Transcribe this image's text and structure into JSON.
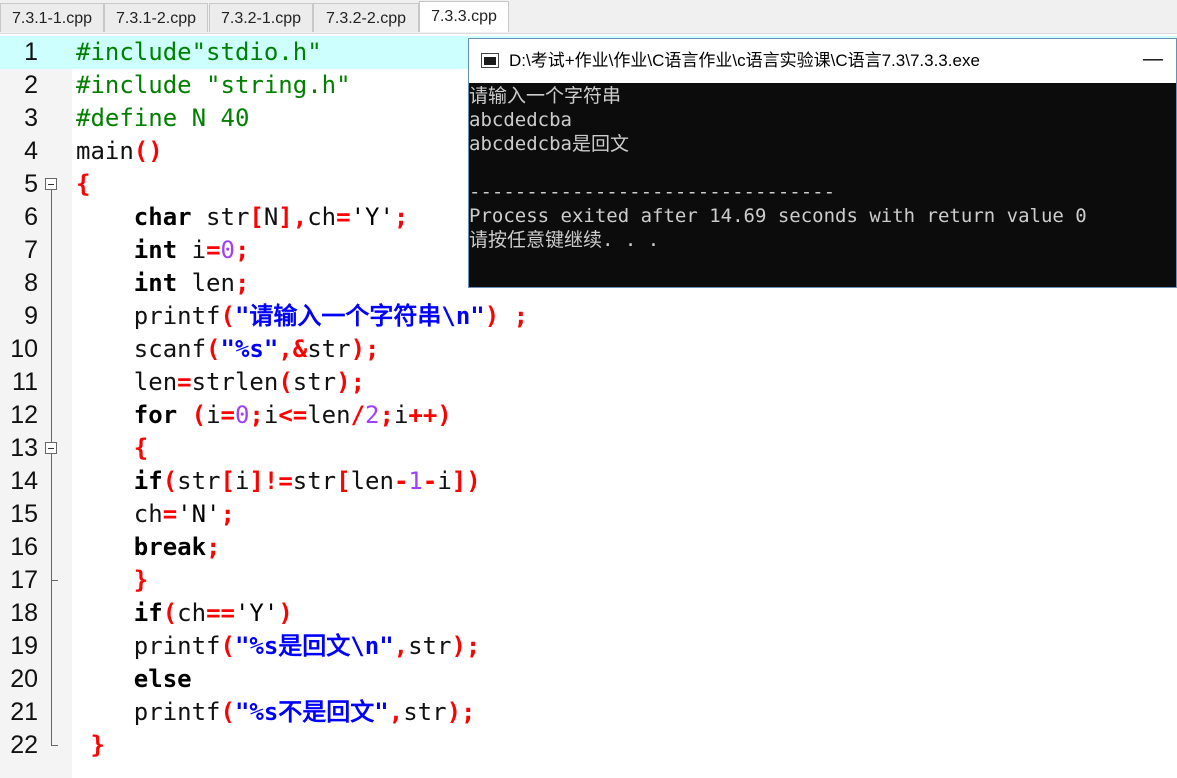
{
  "tabs": [
    "7.3.1-1.cpp",
    "7.3.1-2.cpp",
    "7.3.2-1.cpp",
    "7.3.2-2.cpp",
    "7.3.3.cpp"
  ],
  "active_tab": "7.3.3.cpp",
  "line_numbers": [
    "1",
    "2",
    "3",
    "4",
    "5",
    "6",
    "7",
    "8",
    "9",
    "10",
    "11",
    "12",
    "13",
    "14",
    "15",
    "16",
    "17",
    "18",
    "19",
    "20",
    "21",
    "22"
  ],
  "code": [
    [
      {
        "t": "#include\"stdio.h\"",
        "c": "pp"
      }
    ],
    [
      {
        "t": "#include \"string.h\"",
        "c": "pp"
      }
    ],
    [
      {
        "t": "#define N 40",
        "c": "pp"
      }
    ],
    [
      {
        "t": "main",
        "c": "id"
      },
      {
        "t": "()",
        "c": "sym"
      }
    ],
    [
      {
        "t": "{",
        "c": "sym"
      }
    ],
    [
      {
        "t": "    ",
        "c": "id"
      },
      {
        "t": "char",
        "c": "kw"
      },
      {
        "t": " str",
        "c": "id"
      },
      {
        "t": "[",
        "c": "sym"
      },
      {
        "t": "N",
        "c": "id"
      },
      {
        "t": "],",
        "c": "sym"
      },
      {
        "t": "ch",
        "c": "id"
      },
      {
        "t": "=",
        "c": "sym"
      },
      {
        "t": "'Y'",
        "c": "chr"
      },
      {
        "t": ";",
        "c": "sym"
      }
    ],
    [
      {
        "t": "    ",
        "c": "id"
      },
      {
        "t": "int",
        "c": "kw"
      },
      {
        "t": " i",
        "c": "id"
      },
      {
        "t": "=",
        "c": "sym"
      },
      {
        "t": "0",
        "c": "num"
      },
      {
        "t": ";",
        "c": "sym"
      }
    ],
    [
      {
        "t": "    ",
        "c": "id"
      },
      {
        "t": "int",
        "c": "kw"
      },
      {
        "t": " len",
        "c": "id"
      },
      {
        "t": ";",
        "c": "sym"
      }
    ],
    [
      {
        "t": "    printf",
        "c": "id"
      },
      {
        "t": "(",
        "c": "sym"
      },
      {
        "t": "\"请输入一个字符串\\n\"",
        "c": "str"
      },
      {
        "t": ") ;",
        "c": "sym"
      }
    ],
    [
      {
        "t": "    scanf",
        "c": "id"
      },
      {
        "t": "(",
        "c": "sym"
      },
      {
        "t": "\"%s\"",
        "c": "str"
      },
      {
        "t": ",&",
        "c": "sym"
      },
      {
        "t": "str",
        "c": "id"
      },
      {
        "t": ");",
        "c": "sym"
      }
    ],
    [
      {
        "t": "    len",
        "c": "id"
      },
      {
        "t": "=",
        "c": "sym"
      },
      {
        "t": "strlen",
        "c": "id"
      },
      {
        "t": "(",
        "c": "sym"
      },
      {
        "t": "str",
        "c": "id"
      },
      {
        "t": ");",
        "c": "sym"
      }
    ],
    [
      {
        "t": "    ",
        "c": "id"
      },
      {
        "t": "for",
        "c": "kw"
      },
      {
        "t": " ",
        "c": "id"
      },
      {
        "t": "(",
        "c": "sym"
      },
      {
        "t": "i",
        "c": "id"
      },
      {
        "t": "=",
        "c": "sym"
      },
      {
        "t": "0",
        "c": "num"
      },
      {
        "t": ";",
        "c": "sym"
      },
      {
        "t": "i",
        "c": "id"
      },
      {
        "t": "<=",
        "c": "sym"
      },
      {
        "t": "len",
        "c": "id"
      },
      {
        "t": "/",
        "c": "sym"
      },
      {
        "t": "2",
        "c": "num"
      },
      {
        "t": ";",
        "c": "sym"
      },
      {
        "t": "i",
        "c": "id"
      },
      {
        "t": "++)",
        "c": "sym"
      }
    ],
    [
      {
        "t": "    ",
        "c": "id"
      },
      {
        "t": "{",
        "c": "sym"
      }
    ],
    [
      {
        "t": "    ",
        "c": "id"
      },
      {
        "t": "if",
        "c": "kw"
      },
      {
        "t": "(",
        "c": "sym"
      },
      {
        "t": "str",
        "c": "id"
      },
      {
        "t": "[",
        "c": "sym"
      },
      {
        "t": "i",
        "c": "id"
      },
      {
        "t": "]!=",
        "c": "sym"
      },
      {
        "t": "str",
        "c": "id"
      },
      {
        "t": "[",
        "c": "sym"
      },
      {
        "t": "len",
        "c": "id"
      },
      {
        "t": "-",
        "c": "sym"
      },
      {
        "t": "1",
        "c": "num"
      },
      {
        "t": "-",
        "c": "sym"
      },
      {
        "t": "i",
        "c": "id"
      },
      {
        "t": "])",
        "c": "sym"
      }
    ],
    [
      {
        "t": "    ch",
        "c": "id"
      },
      {
        "t": "=",
        "c": "sym"
      },
      {
        "t": "'N'",
        "c": "chr"
      },
      {
        "t": ";",
        "c": "sym"
      }
    ],
    [
      {
        "t": "    ",
        "c": "id"
      },
      {
        "t": "break",
        "c": "kw"
      },
      {
        "t": ";",
        "c": "sym"
      }
    ],
    [
      {
        "t": "    ",
        "c": "id"
      },
      {
        "t": "}",
        "c": "sym"
      }
    ],
    [
      {
        "t": "    ",
        "c": "id"
      },
      {
        "t": "if",
        "c": "kw"
      },
      {
        "t": "(",
        "c": "sym"
      },
      {
        "t": "ch",
        "c": "id"
      },
      {
        "t": "==",
        "c": "sym"
      },
      {
        "t": "'Y'",
        "c": "chr"
      },
      {
        "t": ")",
        "c": "sym"
      }
    ],
    [
      {
        "t": "    printf",
        "c": "id"
      },
      {
        "t": "(",
        "c": "sym"
      },
      {
        "t": "\"%s是回文\\n\"",
        "c": "str"
      },
      {
        "t": ",",
        "c": "sym"
      },
      {
        "t": "str",
        "c": "id"
      },
      {
        "t": ");",
        "c": "sym"
      }
    ],
    [
      {
        "t": "    ",
        "c": "id"
      },
      {
        "t": "else",
        "c": "kw"
      }
    ],
    [
      {
        "t": "    printf",
        "c": "id"
      },
      {
        "t": "(",
        "c": "sym"
      },
      {
        "t": "\"%s不是回文\"",
        "c": "str"
      },
      {
        "t": ",",
        "c": "sym"
      },
      {
        "t": "str",
        "c": "id"
      },
      {
        "t": ");",
        "c": "sym"
      }
    ],
    [
      {
        "t": " ",
        "c": "id"
      },
      {
        "t": "}",
        "c": "sym"
      }
    ]
  ],
  "console": {
    "title": "D:\\考试+作业\\作业\\C语言作业\\c语言实验课\\C语言7.3\\7.3.3.exe",
    "minimize": "—",
    "lines": [
      "请输入一个字符串",
      "abcdedcba",
      "abcdedcba是回文",
      "",
      "--------------------------------",
      "Process exited after 14.69 seconds with return value 0",
      "请按任意键继续. . ."
    ]
  },
  "colors": {
    "preprocessor": "#008000",
    "string": "#0000ff",
    "symbol": "#ff0000",
    "number": "#a040ff",
    "current_line": "#ccfffe",
    "console_bg": "#0c0c0c",
    "console_text": "#cccccc"
  },
  "icons": {
    "fold": "fold-minus-icon",
    "console": "console-window-icon"
  }
}
